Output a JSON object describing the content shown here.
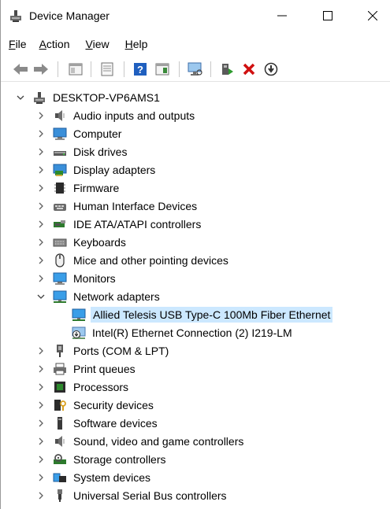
{
  "window": {
    "title": "Device Manager"
  },
  "menu": [
    {
      "pre": "",
      "ul": "F",
      "post": "ile"
    },
    {
      "pre": "",
      "ul": "A",
      "post": "ction"
    },
    {
      "pre": "",
      "ul": "V",
      "post": "iew"
    },
    {
      "pre": "",
      "ul": "H",
      "post": "elp"
    }
  ],
  "toolbar": {
    "buttons": [
      "back-icon",
      "forward-icon",
      "properties-pane-icon",
      "show-hidden-icon",
      "help-icon",
      "action-pane-icon",
      "monitor-scan-icon",
      "update-driver-icon",
      "uninstall-icon",
      "disable-device-icon"
    ]
  },
  "tree": {
    "root": "DESKTOP-VP6AMS1",
    "categories": [
      {
        "label": "Audio inputs and outputs",
        "icon": "speaker-icon"
      },
      {
        "label": "Computer",
        "icon": "computer-icon"
      },
      {
        "label": "Disk drives",
        "icon": "disk-drive-icon"
      },
      {
        "label": "Display adapters",
        "icon": "display-adapter-icon"
      },
      {
        "label": "Firmware",
        "icon": "firmware-icon"
      },
      {
        "label": "Human Interface Devices",
        "icon": "hid-icon"
      },
      {
        "label": "IDE ATA/ATAPI controllers",
        "icon": "ide-controller-icon"
      },
      {
        "label": "Keyboards",
        "icon": "keyboard-icon"
      },
      {
        "label": "Mice and other pointing devices",
        "icon": "mouse-icon"
      },
      {
        "label": "Monitors",
        "icon": "monitor-icon"
      },
      {
        "label": "Network adapters",
        "icon": "network-adapter-icon"
      },
      {
        "label": "Ports (COM & LPT)",
        "icon": "port-icon"
      },
      {
        "label": "Print queues",
        "icon": "printer-icon"
      },
      {
        "label": "Processors",
        "icon": "processor-icon"
      },
      {
        "label": "Security devices",
        "icon": "security-device-icon"
      },
      {
        "label": "Software devices",
        "icon": "software-device-icon"
      },
      {
        "label": "Sound, video and game controllers",
        "icon": "sound-controller-icon"
      },
      {
        "label": "Storage controllers",
        "icon": "storage-controller-icon"
      },
      {
        "label": "System devices",
        "icon": "system-devices-icon"
      },
      {
        "label": "Universal Serial Bus controllers",
        "icon": "usb-icon"
      }
    ],
    "network_children": [
      {
        "label": "Allied Telesis USB Type-C 100Mb Fiber Ethernet",
        "selected": true
      },
      {
        "label": "Intel(R) Ethernet Connection (2) I219-LM",
        "selected": false
      }
    ]
  },
  "colors": {
    "selection": "#cce8ff",
    "accent": "#0078d7"
  }
}
